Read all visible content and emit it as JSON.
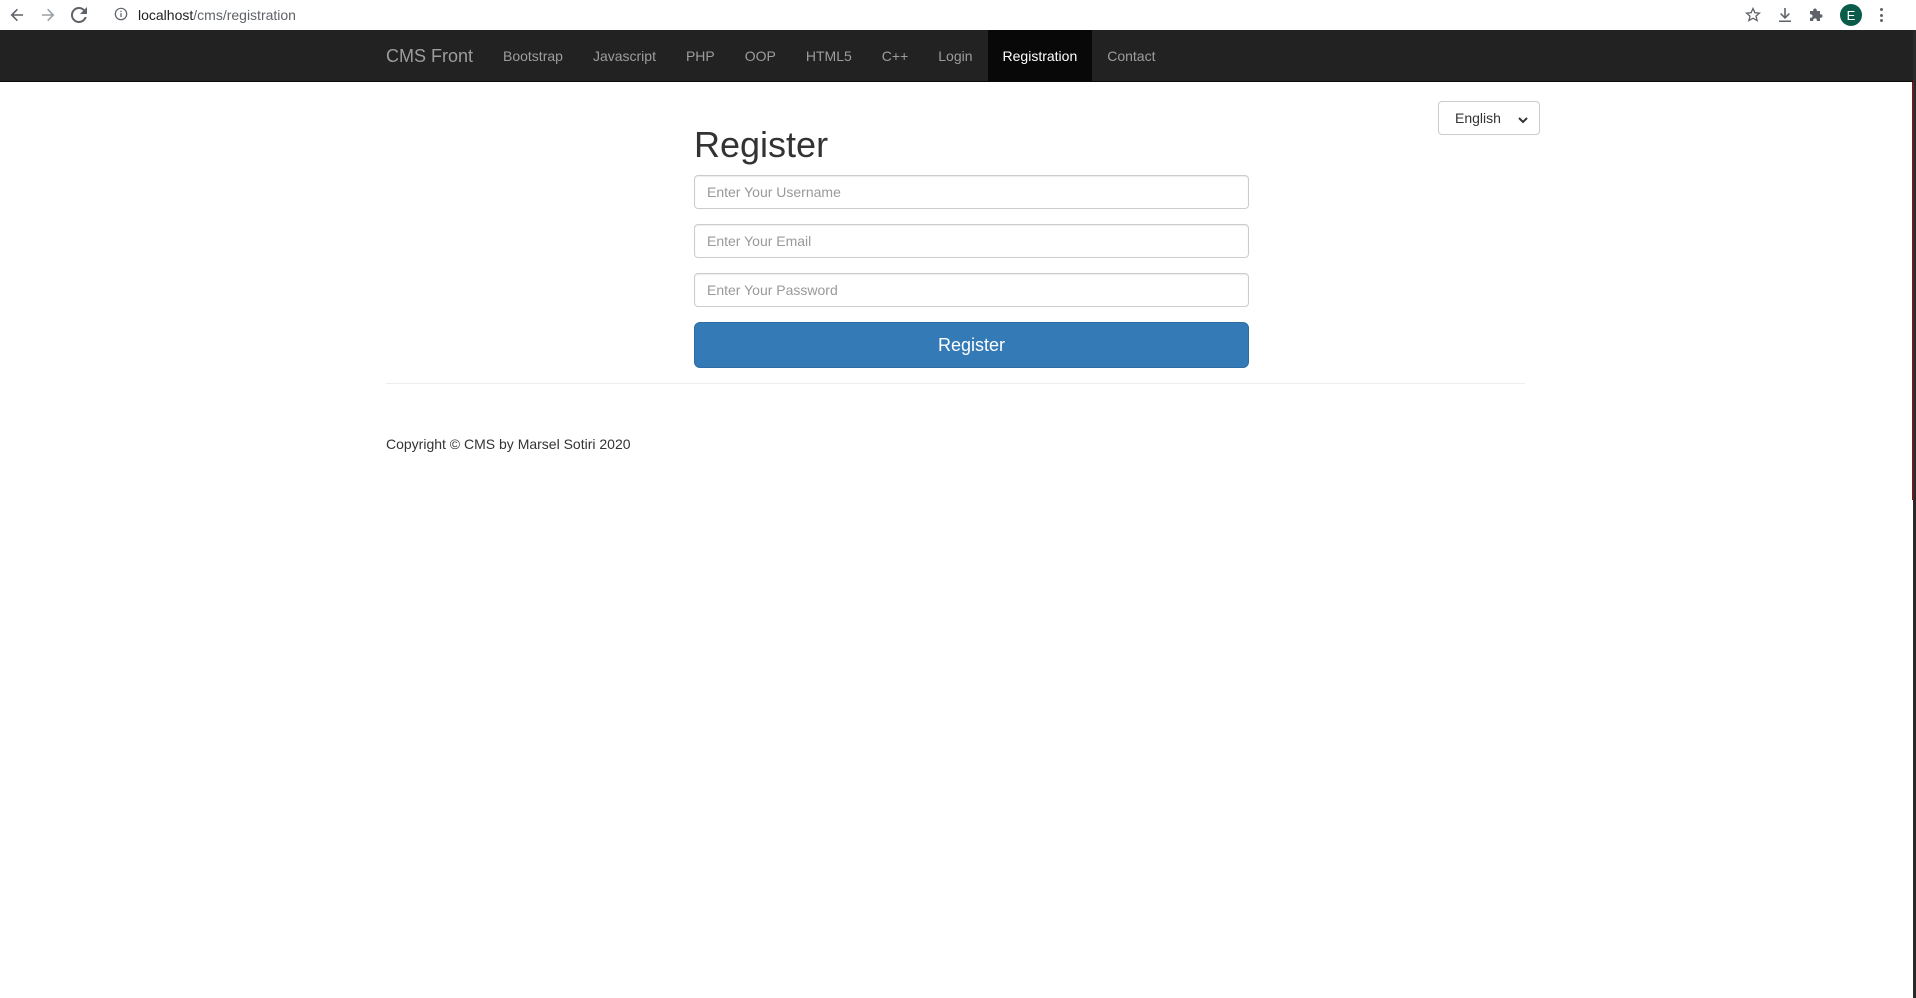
{
  "browser": {
    "url_host": "localhost",
    "url_path": "/cms/registration",
    "avatar_letter": "E"
  },
  "navbar": {
    "brand": "CMS Front",
    "items": [
      {
        "label": "Bootstrap"
      },
      {
        "label": "Javascript"
      },
      {
        "label": "PHP"
      },
      {
        "label": "OOP"
      },
      {
        "label": "HTML5"
      },
      {
        "label": "C++"
      },
      {
        "label": "Login"
      },
      {
        "label": "Registration"
      },
      {
        "label": "Contact"
      }
    ],
    "active": "Registration"
  },
  "language": {
    "selected": "English"
  },
  "form": {
    "title": "Register",
    "username_placeholder": "Enter Your Username",
    "email_placeholder": "Enter Your Email",
    "password_placeholder": "Enter Your Password",
    "submit_label": "Register"
  },
  "footer": {
    "copyright": "Copyright © CMS by Marsel Sotiri 2020"
  },
  "colors": {
    "navbar_bg": "#222222",
    "navbar_active_bg": "#080808",
    "primary": "#337ab7"
  }
}
